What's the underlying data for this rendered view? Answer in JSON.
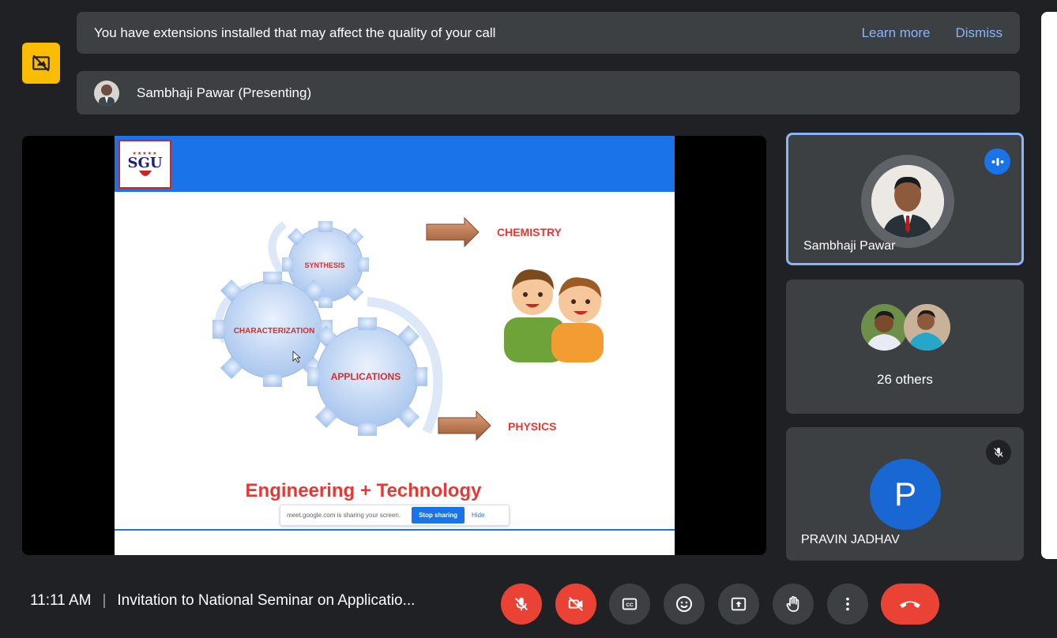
{
  "banner": {
    "text": "You have extensions installed that may affect the quality of your call",
    "learn_more": "Learn more",
    "dismiss": "Dismiss"
  },
  "presenting": {
    "label": "Sambhaji Pawar (Presenting)"
  },
  "slide": {
    "logo_text": "SGU",
    "chemistry": "CHEMISTRY",
    "physics": "PHYSICS",
    "synthesis": "SYNTHESIS",
    "characterization": "CHARACTERIZATION",
    "applications": "APPLICATIONS",
    "footer": "Engineering  + Technology",
    "share_text": "meet.google.com is sharing your screen.",
    "stop_sharing": "Stop sharing",
    "hide": "Hide"
  },
  "tiles": [
    {
      "name": "Sambhaji Pawar",
      "speaking": true
    },
    {
      "name": "26 others"
    },
    {
      "name": "PRAVIN JADHAV",
      "initial": "P",
      "muted": true
    }
  ],
  "bottom": {
    "time": "11:11 AM",
    "separator": "|",
    "meeting_title": "Invitation to National Seminar on Applicatio..."
  },
  "controls": [
    "mic-off-icon",
    "camera-off-icon",
    "captions-icon",
    "emoji-icon",
    "present-icon",
    "raise-hand-icon",
    "more-icon",
    "end-call-icon"
  ],
  "colors": {
    "accent": "#1a73e8",
    "danger": "#ea4335",
    "warning": "#fbbc04",
    "surface": "#3c4043",
    "background": "#202124"
  }
}
